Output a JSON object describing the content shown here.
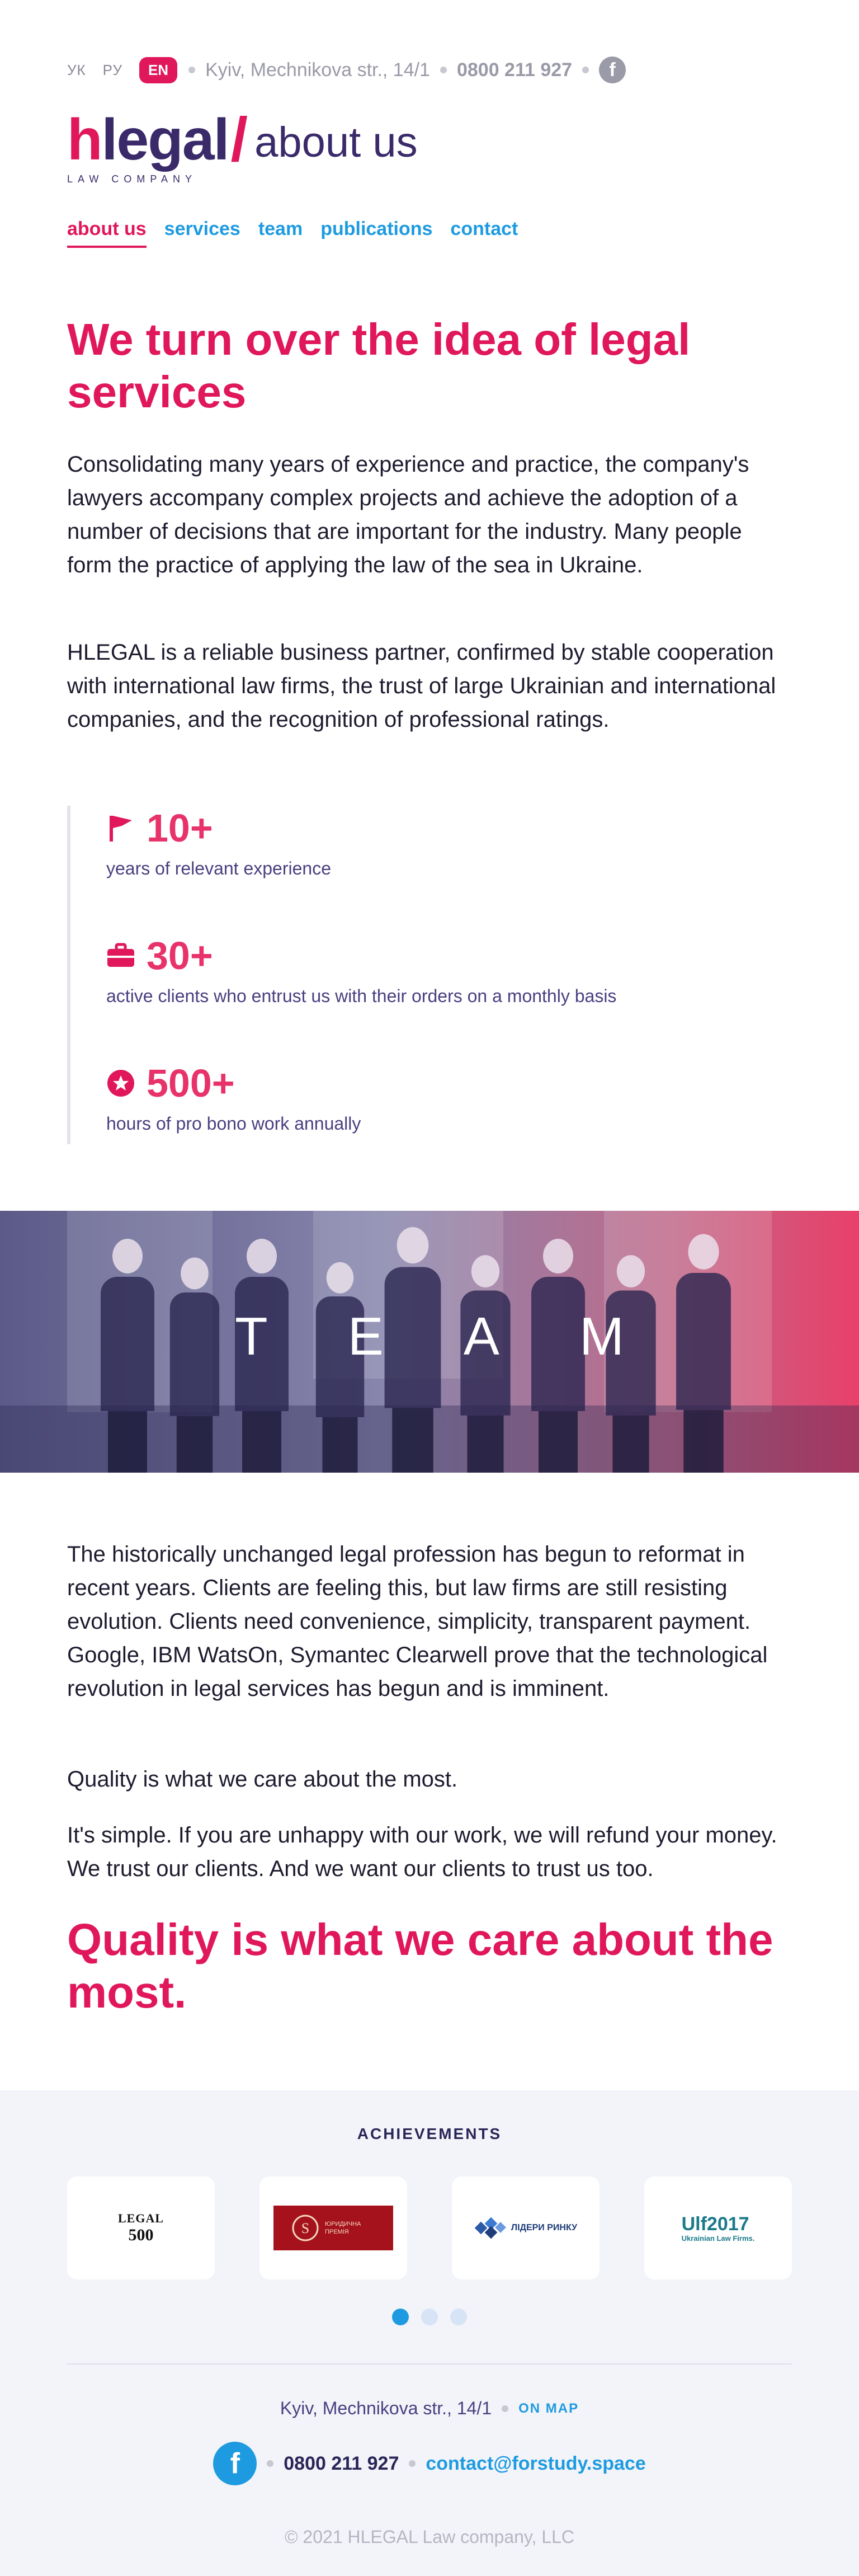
{
  "header": {
    "languages": [
      "УК",
      "РУ",
      "EN"
    ],
    "active_language": "EN",
    "address": "Kyiv, Mechnikova str., 14/1",
    "phone": "0800 211 927",
    "facebook_icon": "facebook-icon"
  },
  "logo": {
    "h": "h",
    "rest": "legal",
    "slash": "/",
    "section": "about us",
    "subtitle": "LAW COMPANY"
  },
  "nav": {
    "items": [
      "about us",
      "services",
      "team",
      "publications",
      "contact"
    ],
    "active": "about us"
  },
  "intro": {
    "title": "We turn over the idea of legal services",
    "p1": "Consolidating many years of experience and practice, the company's lawyers accompany complex projects and achieve the adoption of a number of decisions that are important for the industry. Many people form the practice of applying the law of the sea in Ukraine.",
    "p2": "HLEGAL is a reliable business partner, confirmed by stable cooperation with international law firms, the trust of large Ukrainian and international companies, and the recognition of professional ratings."
  },
  "stats": [
    {
      "icon": "flag-icon",
      "value": "10+",
      "label": "years of relevant experience"
    },
    {
      "icon": "briefcase-icon",
      "value": "30+",
      "label": "active clients who entrust us with their orders on a monthly basis"
    },
    {
      "icon": "star-icon",
      "value": "500+",
      "label": "hours of pro bono work annually"
    }
  ],
  "banner": {
    "letters": [
      "T",
      "E",
      "A",
      "M"
    ]
  },
  "body": {
    "p1": "The historically unchanged legal profession has begun to reformat in recent years. Clients are feeling this, but law firms are still resisting evolution. Clients need convenience, simplicity, transparent payment. Google, IBM WatsOn, Symantec Clearwell prove that the technological revolution in legal services has begun and is imminent.",
    "p2": "Quality is what we care about the most.",
    "p3": "It's simple. If you are unhappy with our work, we will refund your money. We trust our clients. And we want our clients to trust us too.",
    "heading": "Quality is what we care about the most."
  },
  "achievements": {
    "title": "ACHIEVEMENTS",
    "cards": [
      {
        "logo_text_1": "LEGAL",
        "logo_text_2": "500"
      },
      {
        "logo_text_1": "ЮРИДИЧНА ПРЕМІЯ",
        "logo_text_2": ""
      },
      {
        "logo_text_1": "ЛІДЕРИ РИНКУ",
        "logo_text_2": ""
      },
      {
        "logo_text_1": "Ulf2017",
        "logo_text_2": "Ukrainian Law Firms."
      }
    ],
    "pages": 3,
    "active_page": 1
  },
  "footer": {
    "address": "Kyiv, Mechnikova str., 14/1",
    "map_link": "ON MAP",
    "phone": "0800 211 927",
    "email": "contact@forstudy.space",
    "copyright": "© 2021 HLEGAL Law company, LLC"
  },
  "colors": {
    "accent": "#e0175a",
    "link": "#1e9be0",
    "brand_dark": "#3a2a6a"
  }
}
